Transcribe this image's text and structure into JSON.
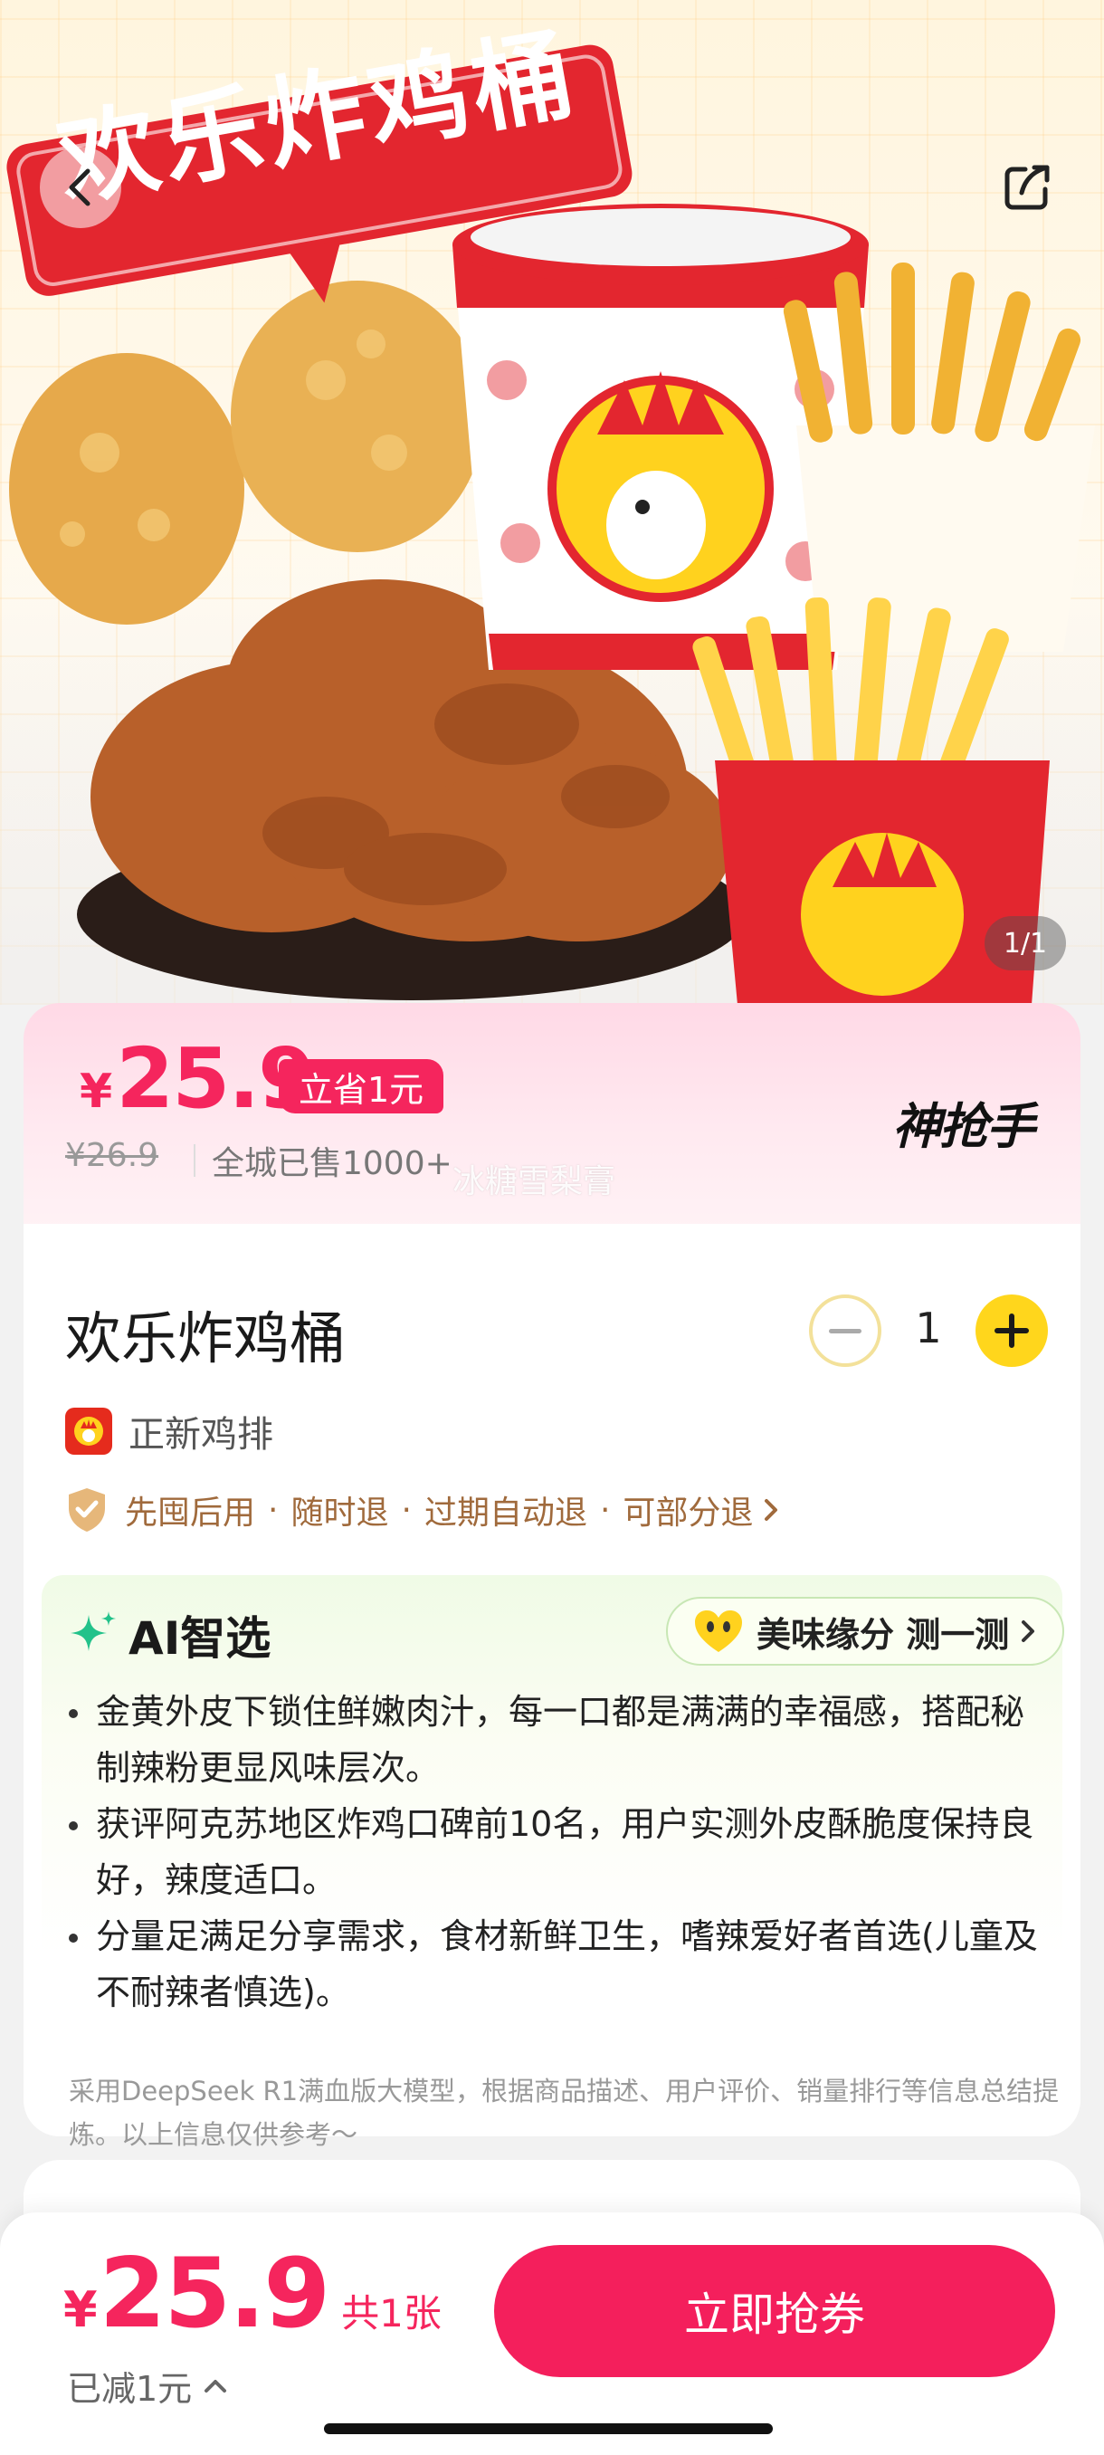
{
  "hero": {
    "banner_text": "欢乐炸鸡桶",
    "image_counter": "1/1"
  },
  "price_banner": {
    "currency": "¥",
    "price": "25.9",
    "save_tag": "立省1元",
    "original_price": "¥26.9",
    "sold_text": "全城已售1000+",
    "brand": "神抢手",
    "watermark": "冰糖雪梨膏"
  },
  "product": {
    "title": "欢乐炸鸡桶",
    "quantity": "1",
    "shop_name": "正新鸡排",
    "policies": [
      "先囤后用",
      "随时退",
      "过期自动退",
      "可部分退"
    ],
    "policy_separator": "·"
  },
  "ai": {
    "title": "AI智选",
    "tag": "美味缘分 测一测",
    "points": [
      "金黄外皮下锁住鲜嫩肉汁，每一口都是满满的幸福感，搭配秘制辣粉更显风味层次。",
      "获评阿克苏地区炸鸡口碑前10名，用户实测外皮酥脆度保持良好，辣度适口。",
      "分量足满足分享需求，食材新鲜卫生，嗜辣爱好者首选(儿童及不耐辣者慎选)。"
    ],
    "note": "采用DeepSeek R1满血版大模型，根据商品描述、用户评价、销量排行等信息总结提炼。以上信息仅供参考～"
  },
  "bottom_bar": {
    "currency": "¥",
    "price": "25.9",
    "count": "共1张",
    "reduced": "已减1元",
    "buy_label": "立即抢券"
  },
  "colors": {
    "accent": "#f5255d",
    "button": "#f41f5c",
    "plus_button": "#ffd61c",
    "policy_text": "#a06a3c"
  },
  "icons": [
    "back-icon",
    "share-icon",
    "minus-icon",
    "plus-icon",
    "shop-logo-icon",
    "shield-icon",
    "sparkle-icon",
    "heart-face-icon",
    "chevron-right-icon",
    "chevron-up-icon"
  ]
}
